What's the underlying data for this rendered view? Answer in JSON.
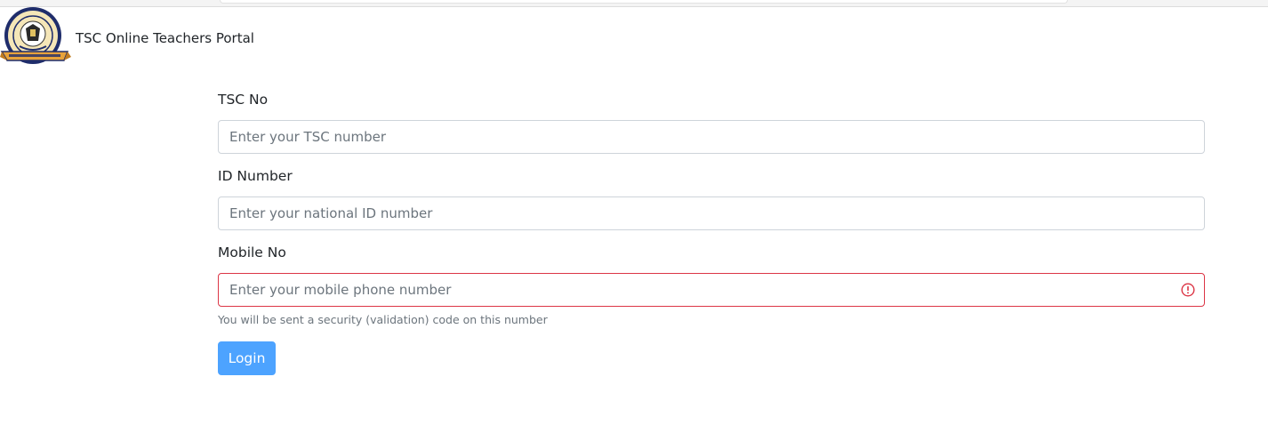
{
  "header": {
    "brand": "TSC Online Teachers Portal",
    "logo_icon": "tsc-seal-logo-icon"
  },
  "form": {
    "tsc_no": {
      "label": "TSC No",
      "placeholder": "Enter your TSC number",
      "value": ""
    },
    "id_number": {
      "label": "ID Number",
      "placeholder": "Enter your national ID number",
      "value": ""
    },
    "mobile_no": {
      "label": "Mobile No",
      "placeholder": "Enter your mobile phone number",
      "value": "",
      "help": "You will be sent a security (validation) code on this number",
      "error_icon": "alert-circle-icon"
    },
    "login_label": "Login"
  },
  "colors": {
    "primary_button": "#4da3ff",
    "invalid_border": "#dc3545",
    "input_border": "#ced4da",
    "placeholder": "#6c757d"
  }
}
